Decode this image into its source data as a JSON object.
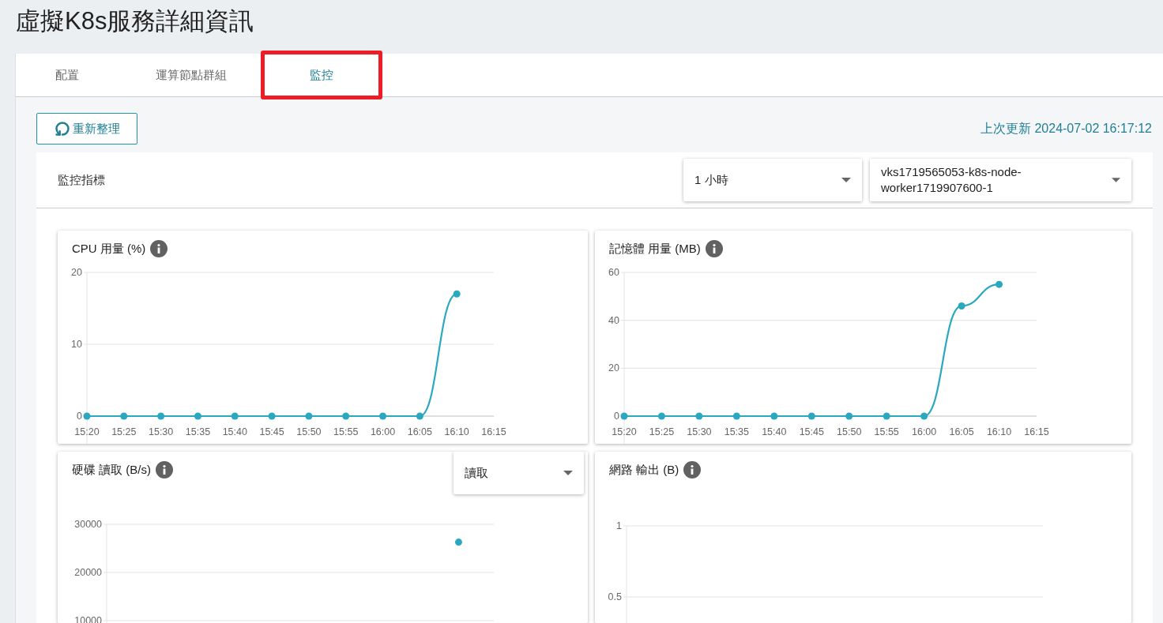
{
  "page_title": "虛擬K8s服務詳細資訊",
  "tabs": [
    {
      "label": "配置",
      "selected": false,
      "highlighted": false
    },
    {
      "label": "運算節點群組",
      "selected": false,
      "highlighted": false
    },
    {
      "label": "監控",
      "selected": true,
      "highlighted": true
    }
  ],
  "refresh_button": "重新整理",
  "last_updated": "上次更新 2024-07-02 16:17:12",
  "metrics_panel": {
    "title": "監控指標",
    "time_range": "1 小時",
    "node": "vks1719565053-k8s-node-worker1719907600-1"
  },
  "charts": [
    {
      "title": "CPU 用量 (%)",
      "chart_data": {
        "type": "line",
        "categories": [
          "15:20",
          "15:25",
          "15:30",
          "15:35",
          "15:40",
          "15:45",
          "15:50",
          "15:55",
          "16:00",
          "16:05",
          "16:10",
          "16:15"
        ],
        "ylim": [
          0,
          20
        ],
        "yticks": [
          0,
          10,
          20
        ],
        "series": [
          {
            "color": "#2aa8c0",
            "marker": true,
            "values": [
              0,
              0,
              0,
              0,
              0,
              0,
              0,
              0,
              0,
              0,
              17,
              null
            ]
          }
        ]
      }
    },
    {
      "title": "記憶體 用量 (MB)",
      "chart_data": {
        "type": "line",
        "categories": [
          "15:20",
          "15:25",
          "15:30",
          "15:35",
          "15:40",
          "15:45",
          "15:50",
          "15:55",
          "16:00",
          "16:05",
          "16:10",
          "16:15"
        ],
        "ylim": [
          0,
          60
        ],
        "yticks": [
          0,
          20,
          40,
          60
        ],
        "series": [
          {
            "color": "#2aa8c0",
            "marker": true,
            "values": [
              0,
              0,
              0,
              0,
              0,
              0,
              0,
              0,
              0,
              46,
              55,
              null
            ]
          }
        ]
      }
    },
    {
      "title": "硬碟 讀取 (B/s)",
      "selector": "讀取",
      "chart_data": {
        "type": "line",
        "ylim": [
          9500,
          30000
        ],
        "yticks": [
          10000,
          20000,
          30000
        ],
        "series": [
          {
            "color": "#2aa8c0",
            "marker": true,
            "values": [
              null,
              null,
              null,
              null,
              null,
              null,
              null,
              null,
              null,
              null,
              26300,
              null
            ]
          }
        ]
      }
    },
    {
      "title": "網路 輸出 (B)",
      "chart_data": {
        "type": "other",
        "annotations": [
          "1",
          "0.5"
        ]
      }
    }
  ]
}
